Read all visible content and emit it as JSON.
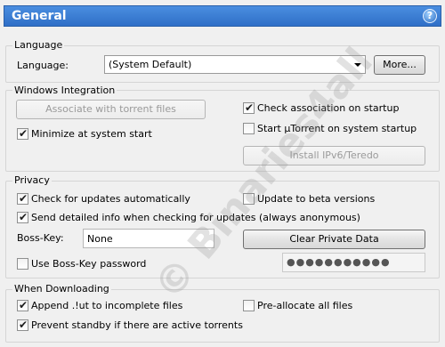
{
  "header": {
    "title": "General",
    "help_label": "?"
  },
  "language": {
    "group_title": "Language",
    "label": "Language:",
    "selected": "(System Default)",
    "more_button": "More..."
  },
  "windows": {
    "group_title": "Windows Integration",
    "associate_button": "Associate with torrent files",
    "minimize_label": "Minimize at system start",
    "check_assoc_label": "Check association on startup",
    "start_label": "Start µTorrent on system startup",
    "ipv6_button": "Install IPv6/Teredo",
    "minimize_checked": true,
    "check_assoc_checked": true,
    "start_checked": false
  },
  "privacy": {
    "group_title": "Privacy",
    "check_updates_label": "Check for updates automatically",
    "beta_label": "Update to beta versions",
    "detailed_label": "Send detailed info when checking for updates (always anonymous)",
    "bosskey_label": "Boss-Key:",
    "bosskey_value": "None",
    "clear_button": "Clear Private Data",
    "bosskey_pwd_label": "Use Boss-Key password",
    "password_value": "●●●●●●●●●●●",
    "check_updates_checked": true,
    "beta_checked": false,
    "detailed_checked": true,
    "bosskey_pwd_checked": false
  },
  "downloading": {
    "group_title": "When Downloading",
    "append_label": "Append .!ut to incomplete files",
    "prealloc_label": "Pre-allocate all files",
    "standby_label": "Prevent standby if there are active torrents",
    "append_checked": true,
    "prealloc_checked": false,
    "standby_checked": true
  },
  "watermark": "© Binaries4all"
}
